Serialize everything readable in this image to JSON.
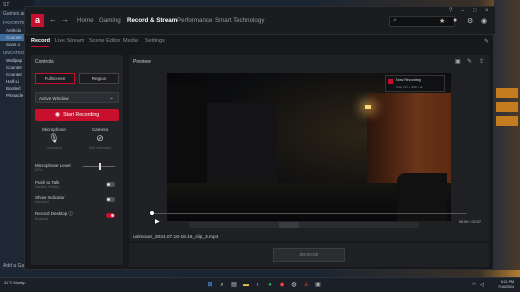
{
  "colors": {
    "accent": "#c8102e",
    "window_bg": "#16181b",
    "panel_bg": "#222428"
  },
  "steam": {
    "title": "ST",
    "header": "Games and S",
    "section_favorites": "FAVORITES",
    "favorites": [
      "Antholo",
      "Counter",
      "Sons o"
    ],
    "section_uncat": "UNCATEGO",
    "items": [
      "Wallpap",
      "Counter",
      "Counter",
      "Half-Li",
      "Borderl",
      "Pinnacle"
    ],
    "footer": "Add a Ga"
  },
  "titlebar": {
    "nav": [
      "Home",
      "Gaming",
      "Record & Stream",
      "Performance",
      "Smart Technology"
    ],
    "active_index": 2,
    "search_icon": "search-icon"
  },
  "subnav": {
    "tabs": [
      "Record",
      "Live Stream",
      "Scene Editor",
      "Media",
      "Settings"
    ],
    "active_index": 0
  },
  "controls": {
    "title": "Controls",
    "mode_fullscreen": "Fullscreen",
    "mode_region": "Region",
    "source": "Active Window",
    "record_button": "Start Recording",
    "microphone": {
      "label": "Microphone",
      "status": "Unmuted"
    },
    "camera": {
      "label": "Camera",
      "status": "Not detected"
    },
    "mic_level": {
      "label": "Microphone Level",
      "sub": "60%",
      "value": 0.5
    },
    "push_to_talk": {
      "label": "Push to Talk",
      "sub": "Disable Hotkey",
      "on": false
    },
    "show_indicator": {
      "label": "Show Indicator",
      "sub": "Disabled",
      "on": false
    },
    "record_desktop": {
      "label": "Record Desktop",
      "sub": "Enabled",
      "on": true
    }
  },
  "preview": {
    "title": "Preview",
    "notification_title": "Now Recording",
    "notification_keys": "Stop   Ctrl + Shift + E",
    "filename": "unknown_2024.07.16-18.16_clip_3.mp4",
    "time": "00:00 / 00:07",
    "progress": 0.0
  },
  "bottom": {
    "counter": "00:00:00"
  },
  "taskbar": {
    "weather": "31°C Mostly...",
    "time": "5:11 PM",
    "date": "7/16/2024"
  }
}
